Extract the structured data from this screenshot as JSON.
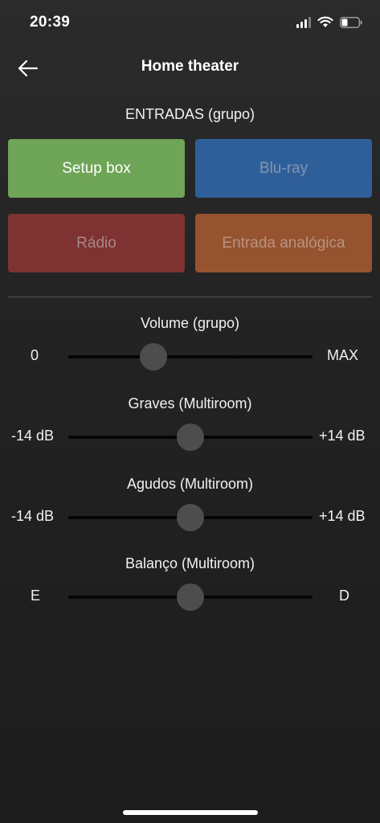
{
  "status_bar": {
    "time": "20:39",
    "icons": [
      "signal-icon",
      "wifi-icon",
      "battery-icon"
    ],
    "battery_level": 0.35
  },
  "header": {
    "back_icon": "arrow-left-icon",
    "title": "Home theater"
  },
  "inputs": {
    "section_label": "ENTRADAS (grupo)",
    "buttons": [
      {
        "label": "Setup box",
        "color": "#6fa556",
        "text_color": "#ffffff",
        "active": true
      },
      {
        "label": "Blu-ray",
        "color": "#2f5f99",
        "text_color": "#8295b1",
        "active": false
      },
      {
        "label": "Rádio",
        "color": "#7e3232",
        "text_color": "#a88787",
        "active": false
      },
      {
        "label": "Entrada analógica",
        "color": "#96532f",
        "text_color": "#b99380",
        "active": false
      }
    ]
  },
  "sliders": [
    {
      "title": "Volume (grupo)",
      "min_label": "0",
      "max_label": "MAX",
      "value": 0.35
    },
    {
      "title": "Graves (Multiroom)",
      "min_label": "-14 dB",
      "max_label": "+14 dB",
      "value": 0.5
    },
    {
      "title": "Agudos (Multiroom)",
      "min_label": "-14 dB",
      "max_label": "+14 dB",
      "value": 0.5
    },
    {
      "title": "Balanço (Multiroom)",
      "min_label": "E",
      "max_label": "D",
      "value": 0.5
    }
  ]
}
